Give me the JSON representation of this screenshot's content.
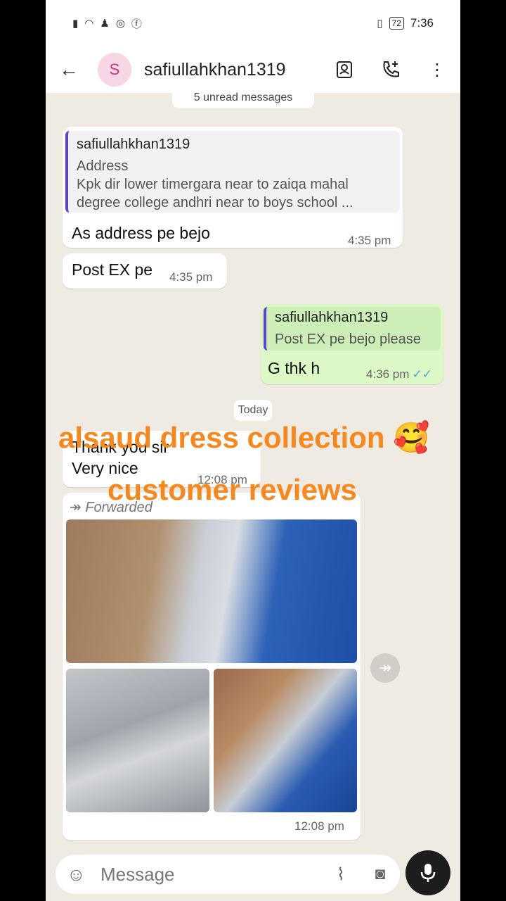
{
  "status_bar": {
    "battery": "72",
    "time": "7:36"
  },
  "header": {
    "avatar_letter": "S",
    "contact_name": "safiullahkhan1319"
  },
  "chat": {
    "unread_banner": "5 unread messages",
    "messages": [
      {
        "direction": "incoming",
        "quote_name": "safiullahkhan1319",
        "quote_line1": "Address",
        "quote_line2": "Kpk dir lower timergara near to zaiqa mahal",
        "quote_line3": "degree college andhri near to boys school ...",
        "text": "As address pe bejo",
        "time": "4:35 pm"
      },
      {
        "direction": "incoming",
        "text": "Post EX pe",
        "time": "4:35 pm"
      },
      {
        "direction": "outgoing",
        "quote_name": "safiullahkhan1319",
        "quote_line1": "Post EX pe bejo please",
        "text": "G thk h",
        "time": "4:36 pm"
      },
      {
        "direction": "incoming",
        "text_line1": "Thank you sir",
        "text_line2": "Very nice",
        "time": "12:08 pm"
      },
      {
        "direction": "incoming",
        "forwarded_label": "Forwarded",
        "time": "12:08 pm"
      }
    ],
    "date_separator": "Today"
  },
  "overlay": {
    "line1": "alsaud dress collection 🥰",
    "line2": "customer reviews"
  },
  "composer": {
    "placeholder": "Message"
  },
  "colors": {
    "accent_quote": "#5b3fd6",
    "outgoing_bubble": "#dcf8c6",
    "overlay_text": "#f5891f"
  }
}
